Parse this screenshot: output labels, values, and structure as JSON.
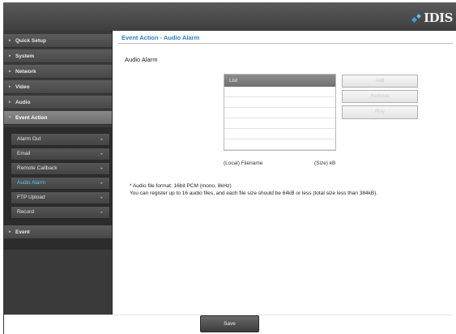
{
  "header": {
    "logo_text": "IDIS"
  },
  "sidebar": {
    "items": [
      {
        "label": "Quick Setup"
      },
      {
        "label": "System"
      },
      {
        "label": "Network"
      },
      {
        "label": "Video"
      },
      {
        "label": "Audio"
      },
      {
        "label": "Event Action"
      },
      {
        "label": "Event"
      }
    ],
    "sub_items": [
      {
        "label": "Alarm Out"
      },
      {
        "label": "Email"
      },
      {
        "label": "Remote Callback"
      },
      {
        "label": "Audio Alarm"
      },
      {
        "label": "FTP Upload"
      },
      {
        "label": "Record"
      }
    ]
  },
  "main": {
    "title": "Event Action - Audio Alarm",
    "section_label": "Audio Alarm",
    "list": {
      "header": "List",
      "rows": [
        "",
        "",
        "",
        "",
        "",
        ""
      ],
      "caption_left": "(Local) Filename",
      "caption_right": "(Size) kB"
    },
    "buttons": {
      "add": "Add",
      "remove": "Remove",
      "play": "Play"
    },
    "notes": [
      "* Audio file format: 16bit PCM (mono, 8kHz)",
      "  You can register up to 16 audio files, and each file size should be 64kB or less (total size less than 384kB)."
    ],
    "save_label": "Save"
  },
  "colors": {
    "accent": "#2f7fbf",
    "selected_sub": "#55c8f0",
    "sidebar_bg": "#3a3a3a",
    "header_bg": "#4a4a4a"
  },
  "icons": {
    "collapsed": "chevron-right-icon",
    "expanded": "chevron-down-icon",
    "sub_arrow": "caret-right-icon",
    "logo": "idis-logo-mark"
  }
}
